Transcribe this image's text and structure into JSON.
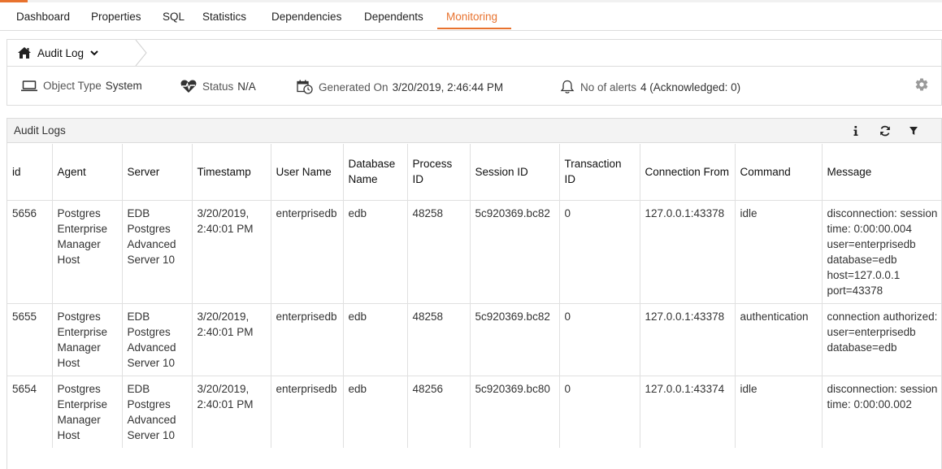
{
  "colors": {
    "accent": "#e8722e",
    "border": "#dcdcdc",
    "panel_header": "#f3f3f3"
  },
  "tabs": [
    {
      "label": "Dashboard"
    },
    {
      "label": "Properties"
    },
    {
      "label": "SQL"
    },
    {
      "label": "Statistics"
    },
    {
      "label": "Dependencies"
    },
    {
      "label": "Dependents"
    },
    {
      "label": "Monitoring",
      "active": true
    }
  ],
  "breadcrumb": {
    "home_icon": "home-icon",
    "current": "Audit Log"
  },
  "info": {
    "object_type": {
      "icon": "monitor-icon",
      "label": "Object Type",
      "value": "System"
    },
    "status": {
      "icon": "heartbeat-icon",
      "label": "Status",
      "value": "N/A"
    },
    "generated_on": {
      "icon": "calendar-clock-icon",
      "label": "Generated On",
      "value": "3/20/2019, 2:46:44 PM"
    },
    "alerts": {
      "icon": "bell-icon",
      "label": "No of alerts",
      "value": "4 (Acknowledged: 0)"
    }
  },
  "panel": {
    "title": "Audit Logs"
  },
  "table": {
    "columns": [
      "id",
      "Agent",
      "Server",
      "Timestamp",
      "User Name",
      "Database Name",
      "Process ID",
      "Session ID",
      "Transaction ID",
      "Connection From",
      "Command",
      "Message"
    ],
    "rows": [
      [
        "5656",
        "Postgres Enterprise Manager Host",
        "EDB Postgres Advanced Server 10",
        "3/20/2019, 2:40:01 PM",
        "enterprisedb",
        "edb",
        "48258",
        "5c920369.bc82",
        "0",
        "127.0.0.1:43378",
        "idle",
        "disconnection: session time: 0:00:00.004 user=enterprisedb database=edb host=127.0.0.1 port=43378"
      ],
      [
        "5655",
        "Postgres Enterprise Manager Host",
        "EDB Postgres Advanced Server 10",
        "3/20/2019, 2:40:01 PM",
        "enterprisedb",
        "edb",
        "48258",
        "5c920369.bc82",
        "0",
        "127.0.0.1:43378",
        "authentication",
        "connection authorized: user=enterprisedb database=edb"
      ],
      [
        "5654",
        "Postgres Enterprise Manager Host",
        "EDB Postgres Advanced Server 10",
        "3/20/2019, 2:40:01 PM",
        "enterprisedb",
        "edb",
        "48256",
        "5c920369.bc80",
        "0",
        "127.0.0.1:43374",
        "idle",
        "disconnection: session time: 0:00:00.002"
      ]
    ]
  }
}
